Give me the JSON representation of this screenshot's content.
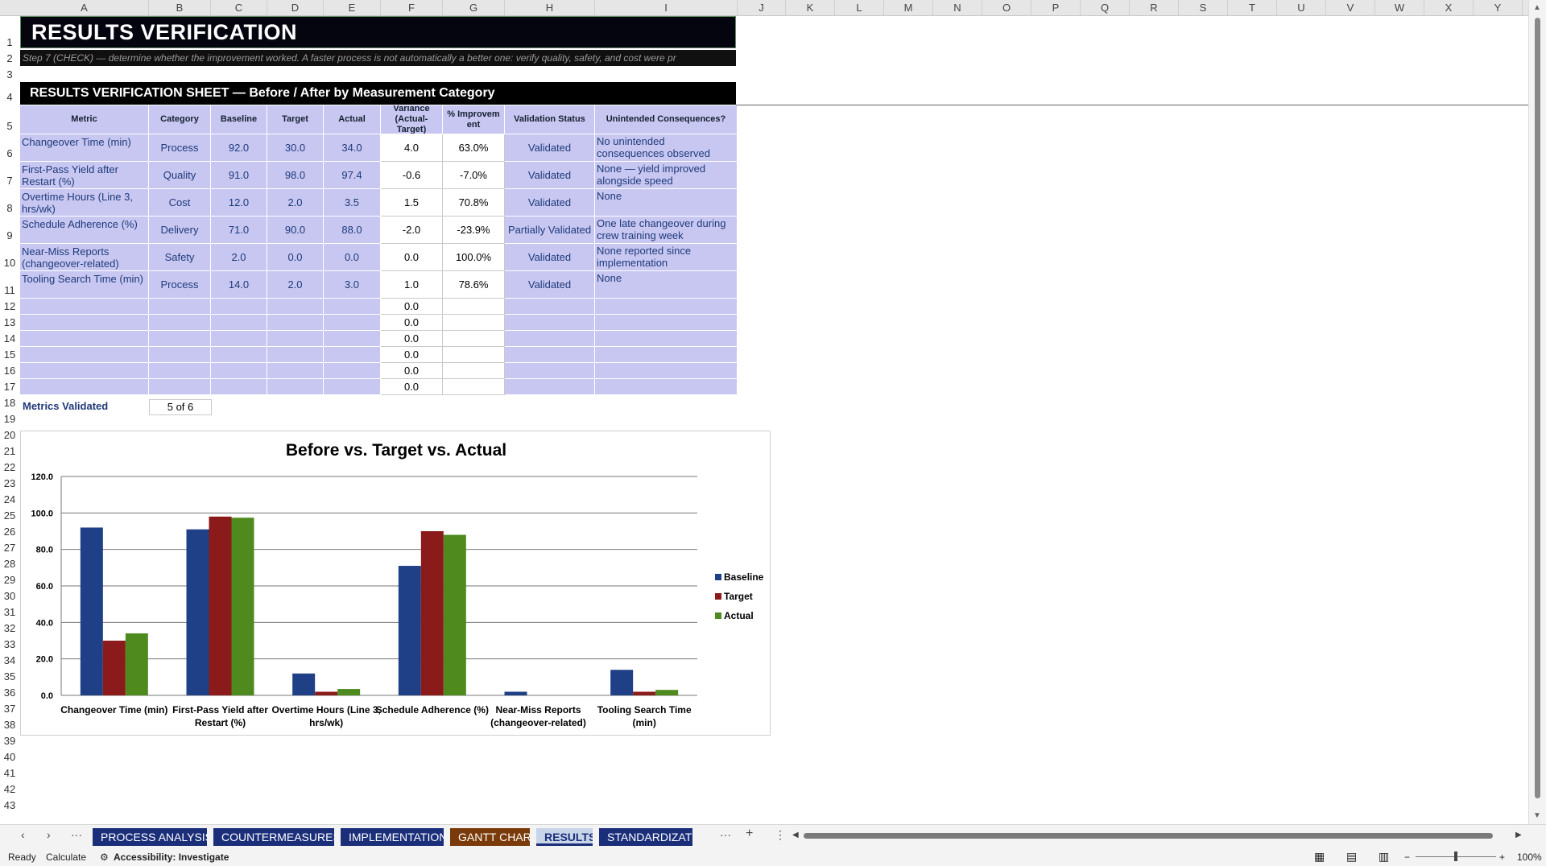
{
  "columns": [
    "A",
    "B",
    "C",
    "D",
    "E",
    "F",
    "G",
    "H",
    "I",
    "J",
    "K",
    "L",
    "M",
    "N",
    "O",
    "P",
    "Q",
    "R",
    "S",
    "T",
    "U",
    "V",
    "W",
    "X",
    "Y"
  ],
  "rows": [
    "1",
    "2",
    "3",
    "4",
    "5",
    "6",
    "7",
    "8",
    "9",
    "10",
    "11",
    "12",
    "13",
    "14",
    "15",
    "16",
    "17",
    "18",
    "19",
    "20",
    "21",
    "22",
    "23",
    "24",
    "25",
    "26",
    "27",
    "28",
    "29",
    "30",
    "31",
    "32",
    "33",
    "34",
    "35",
    "36",
    "37",
    "38",
    "39",
    "40",
    "41",
    "42",
    "43"
  ],
  "sheet": {
    "title": "RESULTS VERIFICATION",
    "subtitle": "Step 7 (CHECK) — determine whether the improvement worked. A faster process is not automatically a better one: verify quality, safety, and cost were pr",
    "section_header": "RESULTS VERIFICATION SHEET — Before / After by Measurement Category"
  },
  "table": {
    "headers": [
      "Metric",
      "Category",
      "Baseline",
      "Target",
      "Actual",
      "Variance (Actual-Target)",
      "% Improvem ent",
      "Validation Status",
      "Unintended Consequences?"
    ],
    "rows": [
      {
        "metric": "Changeover Time (min)",
        "category": "Process",
        "baseline": "92.0",
        "target": "30.0",
        "actual": "34.0",
        "variance": "4.0",
        "improvement": "63.0%",
        "status": "Validated",
        "consequences": "No unintended consequences observed"
      },
      {
        "metric": "First-Pass Yield after Restart (%)",
        "category": "Quality",
        "baseline": "91.0",
        "target": "98.0",
        "actual": "97.4",
        "variance": "-0.6",
        "improvement": "-7.0%",
        "status": "Validated",
        "consequences": "None — yield improved alongside speed"
      },
      {
        "metric": "Overtime Hours (Line 3, hrs/wk)",
        "category": "Cost",
        "baseline": "12.0",
        "target": "2.0",
        "actual": "3.5",
        "variance": "1.5",
        "improvement": "70.8%",
        "status": "Validated",
        "consequences": "None"
      },
      {
        "metric": "Schedule Adherence (%)",
        "category": "Delivery",
        "baseline": "71.0",
        "target": "90.0",
        "actual": "88.0",
        "variance": "-2.0",
        "improvement": "-23.9%",
        "status": "Partially Validated",
        "consequences": "One late changeover during crew training week"
      },
      {
        "metric": "Near-Miss Reports (changeover-related)",
        "category": "Safety",
        "baseline": "2.0",
        "target": "0.0",
        "actual": "0.0",
        "variance": "0.0",
        "improvement": "100.0%",
        "status": "Validated",
        "consequences": "None reported since implementation"
      },
      {
        "metric": "Tooling Search Time (min)",
        "category": "Process",
        "baseline": "14.0",
        "target": "2.0",
        "actual": "3.0",
        "variance": "1.0",
        "improvement": "78.6%",
        "status": "Validated",
        "consequences": "None"
      }
    ],
    "empty_variances": [
      "0.0",
      "0.0",
      "0.0",
      "0.0",
      "0.0",
      "0.0"
    ]
  },
  "summary": {
    "label": "Metrics Validated",
    "value": "5 of 6"
  },
  "chart_data": {
    "type": "bar",
    "title": "Before vs. Target vs. Actual",
    "categories": [
      "Changeover Time (min)",
      "First-Pass Yield after Restart (%)",
      "Overtime Hours (Line 3, hrs/wk)",
      "Schedule Adherence (%)",
      "Near-Miss Reports (changeover-related)",
      "Tooling Search Time (min)"
    ],
    "category_lines": [
      [
        "Changeover Time (min)"
      ],
      [
        "First-Pass Yield after",
        "Restart (%)"
      ],
      [
        "Overtime Hours (Line 3,",
        "hrs/wk)"
      ],
      [
        "Schedule Adherence (%)"
      ],
      [
        "Near-Miss Reports",
        "(changeover-related)"
      ],
      [
        "Tooling Search Time",
        "(min)"
      ]
    ],
    "series": [
      {
        "name": "Baseline",
        "color": "#1f3f87",
        "values": [
          92.0,
          91.0,
          12.0,
          71.0,
          2.0,
          14.0
        ]
      },
      {
        "name": "Target",
        "color": "#8b1a1a",
        "values": [
          30.0,
          98.0,
          2.0,
          90.0,
          0.0,
          2.0
        ]
      },
      {
        "name": "Actual",
        "color": "#4f8a1e",
        "values": [
          34.0,
          97.4,
          3.5,
          88.0,
          0.0,
          3.0
        ]
      }
    ],
    "yticks": [
      "0.0",
      "20.0",
      "40.0",
      "60.0",
      "80.0",
      "100.0",
      "120.0"
    ],
    "ylim": [
      0,
      120
    ],
    "legend": "right",
    "grid": true
  },
  "tabs": [
    {
      "label": "PROCESS ANALYSIS",
      "color": "#1a2e7a",
      "active": false
    },
    {
      "label": "COUNTERMEASURES",
      "color": "#1a2e7a",
      "active": false
    },
    {
      "label": "IMPLEMENTATION",
      "color": "#1a2e7a",
      "active": false
    },
    {
      "label": "GANTT CHART",
      "color": "#7a3a0a",
      "active": false
    },
    {
      "label": "RESULTS",
      "color": "#c8d4e8",
      "active": true
    },
    {
      "label": "STANDARDIZATI",
      "color": "#1a2e7a",
      "active": false
    }
  ],
  "tabbar": {
    "more": "···",
    "more2": "···",
    "add": "+",
    "menu": "⋮"
  },
  "status": {
    "ready": "Ready",
    "calculate": "Calculate",
    "accessibility": "Accessibility: Investigate",
    "zoom": "100%"
  }
}
